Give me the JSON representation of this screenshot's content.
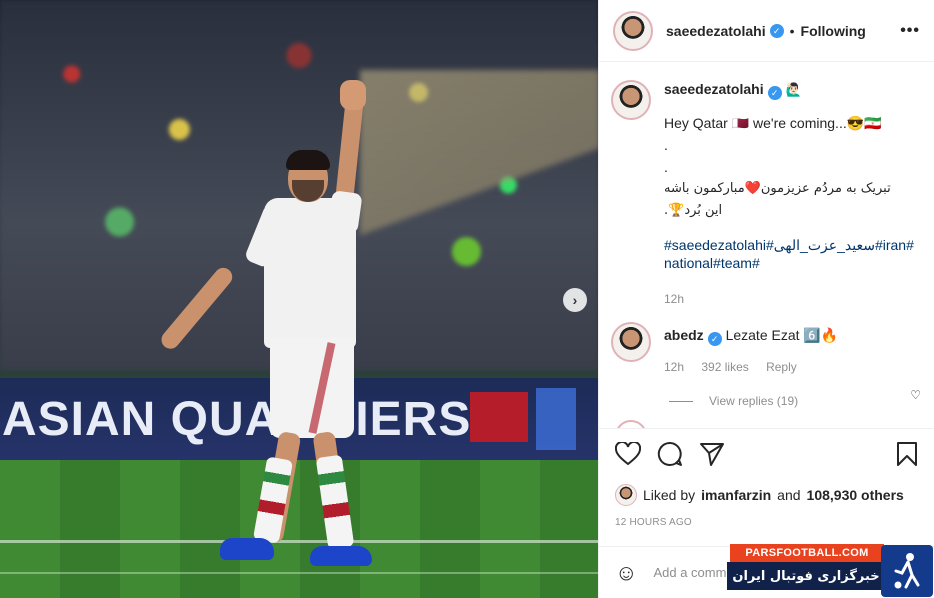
{
  "post": {
    "username": "saeedezatolahi",
    "follow_status": "Following",
    "more_label": "•••",
    "next_label": "›"
  },
  "photo": {
    "board_text": "ASIAN QUALIFIERS"
  },
  "caption": {
    "username": "saeedezatolahi",
    "user_emoji": "🙋🏻‍♂️",
    "line1": "Hey Qatar 🇶🇦 we're coming...😎🇮🇷",
    "dot1": ".",
    "dot2": ".",
    "persian1": "تبریک به مردُم عزیزمون❤️مبارکمون باشه",
    "persian2": "این بُرد🏆.",
    "hashtags": "#saeedezatolahi#سعید_عزت_الهی#iran#national#team#",
    "time": "12h"
  },
  "comment": {
    "username": "abedz",
    "text": "Lezate Ezat 6️⃣🔥",
    "time": "12h",
    "likes": "392 likes",
    "reply": "Reply",
    "view_replies": "View replies (19)",
    "heart": "♡"
  },
  "actions": {
    "like_icon": "heart-icon",
    "comment_icon": "comment-icon",
    "share_icon": "share-icon",
    "save_icon": "bookmark-icon"
  },
  "likes": {
    "prefix": "Liked by",
    "user": "imanfarzin",
    "and": "and",
    "count": "108,930 others"
  },
  "timestamp": "12 HOURS AGO",
  "add_comment": {
    "placeholder": "Add a comment..."
  },
  "watermark": {
    "site": "PARSFOOTBALL.COM",
    "tagline": "خبرگزاری فوتبال ایران"
  }
}
